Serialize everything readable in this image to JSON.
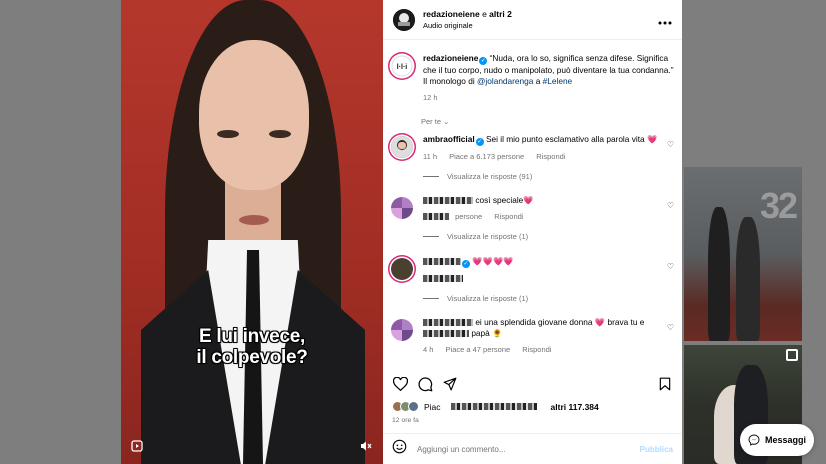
{
  "header": {
    "username": "redazioneiene",
    "connector": "e",
    "others": "altri 2",
    "audio": "Audio originale",
    "more_icon": "more-horizontal-icon"
  },
  "video": {
    "caption_line1": "E lui invece,",
    "caption_line2": "il colpevole?",
    "reel_icon": "reel-icon",
    "mute_icon": "mute-icon"
  },
  "post": {
    "username": "redazioneiene",
    "text": "“Nuda, ora lo so, significa senza difese. Significa che il tuo corpo, nudo o manipolato, può diventare la tua condanna.” Il monologo di",
    "mention": "@jolandarenga",
    "connector": "a",
    "hashtag": "#Lelene",
    "time": "12 h"
  },
  "translate": {
    "label": "Per te"
  },
  "comments": [
    {
      "username": "ambraofficial",
      "text": "Sei il mio punto esclamativo alla parola vita",
      "emoji": "💗",
      "time": "11 h",
      "likes": "Piace a 6.173 persone",
      "reply": "Rispondi",
      "replies": "Visualizza le risposte (91)"
    },
    {
      "text": "così speciale",
      "emoji": "💗",
      "likes": "persone",
      "reply": "Rispondi",
      "replies": "Visualizza le risposte (1)"
    },
    {
      "emojis": "💗💗💗💗",
      "replies": "Visualizza le risposte (1)"
    },
    {
      "text_a": "ei una splendida giovane donna",
      "emoji": "💗",
      "text_b": "brava tu e",
      "text_c": "papà",
      "emoji_end": "🌻",
      "time": "4 h",
      "likes": "Piace a 47 persone",
      "reply": "Rispondi"
    }
  ],
  "likes": {
    "prefix": "Piac",
    "suffix": "altri 117.384"
  },
  "post_time": "12 ore fa",
  "comment_bar": {
    "placeholder": "Aggiungi un commento...",
    "post_label": "Pubblica"
  },
  "messages": {
    "label": "Messaggi"
  },
  "background": {
    "thumb_number": "32"
  }
}
